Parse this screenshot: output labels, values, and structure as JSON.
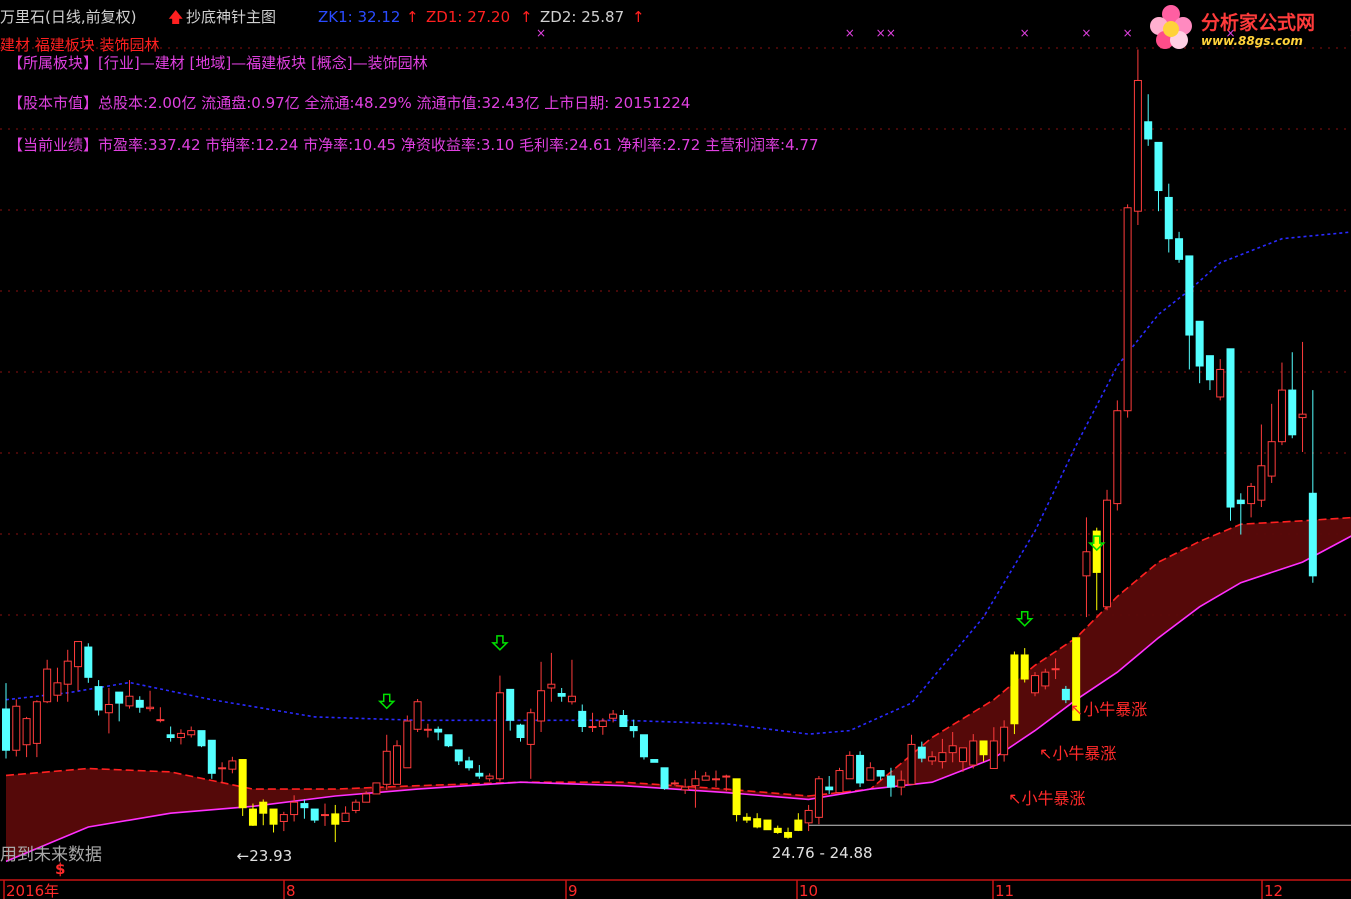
{
  "header": {
    "stock_name": "万里石(日线,前复权)",
    "indicator_name": "抄底神针主图",
    "zk1_label": "ZK1: 32.12",
    "zd1_label": "ZD1: 27.20",
    "zd2_label": "ZD2: 25.87"
  },
  "info": {
    "sector_short": "建材 福建板块 装饰园林",
    "sector_line": "【所属板块】[行业]—建材 [地域]—福建板块 [概念]—装饰园林",
    "equity_line": "【股本市值】总股本:2.00亿 流通盘:0.97亿 全流通:48.29% 流通市值:32.43亿 上市日期: 20151224",
    "performance_line": "【当前业绩】市盈率:337.42 市销率:12.24 市净率:10.45 净资收益率:3.10 毛利率:24.61 净利率:2.72 主营利润率:4.77"
  },
  "logo": {
    "title": "分析家公式网",
    "url": "www.88gs.com"
  },
  "footer": {
    "future_data_note": "用到未来数据",
    "dollar_mark": "$"
  },
  "colors": {
    "background": "#000000",
    "up_candle": "#ff3c3c",
    "down_candle": "#54ffff",
    "buy_signal_candle": "#ffff00",
    "band_fill": "#5a0a0a",
    "band_edge_red": "#ff2020",
    "band_edge_magenta": "#ff30ff",
    "blue_dotted_line": "#2a2aff",
    "grid": "#8a1010",
    "signal_arrow": "#00e000",
    "signal_text": "#ff2a2a",
    "header_text": "#d0d0d0",
    "info_text": "#e040e0"
  },
  "chart_data": {
    "type": "candlestick",
    "title": "抄底神针主图",
    "ylim": [
      21.3,
      46.3
    ],
    "x_ticks": [
      "2016年",
      "8",
      "9",
      "10",
      "11",
      "12"
    ],
    "candles": [
      {
        "o": 26.33,
        "h": 27.08,
        "l": 24.89,
        "c": 25.13
      },
      {
        "o": 25.13,
        "h": 26.61,
        "l": 24.95,
        "c": 26.41
      },
      {
        "o": 25.29,
        "h": 26.1,
        "l": 24.93,
        "c": 26.05
      },
      {
        "o": 25.33,
        "h": 26.58,
        "l": 24.93,
        "c": 26.54
      },
      {
        "o": 26.54,
        "h": 27.76,
        "l": 26.5,
        "c": 27.49
      },
      {
        "o": 26.73,
        "h": 27.53,
        "l": 26.54,
        "c": 27.09
      },
      {
        "o": 27.05,
        "h": 28.05,
        "l": 26.54,
        "c": 27.72
      },
      {
        "o": 27.56,
        "h": 28.29,
        "l": 26.86,
        "c": 28.29
      },
      {
        "o": 28.13,
        "h": 28.24,
        "l": 27.09,
        "c": 27.25
      },
      {
        "o": 26.98,
        "h": 27.17,
        "l": 26.14,
        "c": 26.3
      },
      {
        "o": 26.22,
        "h": 26.94,
        "l": 25.62,
        "c": 26.46
      },
      {
        "o": 26.82,
        "h": 26.82,
        "l": 25.97,
        "c": 26.5
      },
      {
        "o": 26.42,
        "h": 27.17,
        "l": 26.34,
        "c": 26.7
      },
      {
        "o": 26.58,
        "h": 26.7,
        "l": 26.22,
        "c": 26.38
      },
      {
        "o": 26.34,
        "h": 26.86,
        "l": 26.26,
        "c": 26.38
      },
      {
        "o": 26.02,
        "h": 26.38,
        "l": 25.94,
        "c": 26.02
      },
      {
        "o": 25.58,
        "h": 25.82,
        "l": 25.38,
        "c": 25.5
      },
      {
        "o": 25.5,
        "h": 25.74,
        "l": 25.3,
        "c": 25.62
      },
      {
        "o": 25.58,
        "h": 25.82,
        "l": 25.5,
        "c": 25.7
      },
      {
        "o": 25.7,
        "h": 25.7,
        "l": 25.22,
        "c": 25.26
      },
      {
        "o": 25.42,
        "h": 25.42,
        "l": 24.3,
        "c": 24.46
      },
      {
        "o": 24.62,
        "h": 24.78,
        "l": 24.18,
        "c": 24.62
      },
      {
        "o": 24.58,
        "h": 24.94,
        "l": 24.46,
        "c": 24.82
      },
      {
        "o": 24.86,
        "h": 24.86,
        "l": 23.22,
        "c": 23.46
      },
      {
        "o": 23.42,
        "h": 23.58,
        "l": 22.93,
        "c": 22.95
      },
      {
        "o": 23.3,
        "h": 23.7,
        "l": 22.95,
        "c": 23.62
      },
      {
        "o": 23.42,
        "h": 23.42,
        "l": 22.74,
        "c": 22.98
      },
      {
        "o": 23.06,
        "h": 23.34,
        "l": 22.78,
        "c": 23.26
      },
      {
        "o": 23.26,
        "h": 23.82,
        "l": 23.06,
        "c": 23.62
      },
      {
        "o": 23.58,
        "h": 23.7,
        "l": 23.14,
        "c": 23.46
      },
      {
        "o": 23.42,
        "h": 23.42,
        "l": 23.02,
        "c": 23.1
      },
      {
        "o": 23.26,
        "h": 23.58,
        "l": 22.93,
        "c": 23.26
      },
      {
        "o": 23.28,
        "h": 23.54,
        "l": 22.46,
        "c": 22.98
      },
      {
        "o": 23.06,
        "h": 23.5,
        "l": 23.06,
        "c": 23.3
      },
      {
        "o": 23.38,
        "h": 23.7,
        "l": 23.3,
        "c": 23.62
      },
      {
        "o": 23.62,
        "h": 23.94,
        "l": 23.62,
        "c": 23.86
      },
      {
        "o": 23.86,
        "h": 24.18,
        "l": 23.86,
        "c": 24.18
      },
      {
        "o": 24.14,
        "h": 25.58,
        "l": 23.98,
        "c": 25.1
      },
      {
        "o": 24.14,
        "h": 25.42,
        "l": 24.14,
        "c": 25.26
      },
      {
        "o": 24.62,
        "h": 26.14,
        "l": 24.62,
        "c": 25.98
      },
      {
        "o": 25.74,
        "h": 26.62,
        "l": 25.66,
        "c": 26.54
      },
      {
        "o": 25.74,
        "h": 25.9,
        "l": 25.5,
        "c": 25.74
      },
      {
        "o": 25.74,
        "h": 25.82,
        "l": 25.42,
        "c": 25.66
      },
      {
        "o": 25.58,
        "h": 25.58,
        "l": 25.22,
        "c": 25.26
      },
      {
        "o": 25.14,
        "h": 25.14,
        "l": 24.7,
        "c": 24.82
      },
      {
        "o": 24.82,
        "h": 24.94,
        "l": 24.54,
        "c": 24.62
      },
      {
        "o": 24.46,
        "h": 24.7,
        "l": 24.3,
        "c": 24.38
      },
      {
        "o": 24.3,
        "h": 24.46,
        "l": 24.22,
        "c": 24.38
      },
      {
        "o": 24.3,
        "h": 27.3,
        "l": 24.22,
        "c": 26.8
      },
      {
        "o": 26.9,
        "h": 26.9,
        "l": 25.7,
        "c": 26.0
      },
      {
        "o": 25.86,
        "h": 25.9,
        "l": 25.38,
        "c": 25.5
      },
      {
        "o": 25.3,
        "h": 26.34,
        "l": 24.3,
        "c": 26.22
      },
      {
        "o": 25.98,
        "h": 27.7,
        "l": 25.66,
        "c": 26.86
      },
      {
        "o": 26.94,
        "h": 27.96,
        "l": 26.54,
        "c": 27.05
      },
      {
        "o": 26.78,
        "h": 26.94,
        "l": 26.54,
        "c": 26.7
      },
      {
        "o": 26.54,
        "h": 27.76,
        "l": 26.46,
        "c": 26.7
      },
      {
        "o": 26.26,
        "h": 26.46,
        "l": 25.66,
        "c": 25.82
      },
      {
        "o": 25.82,
        "h": 26.22,
        "l": 25.66,
        "c": 25.82
      },
      {
        "o": 25.82,
        "h": 26.06,
        "l": 25.58,
        "c": 25.98
      },
      {
        "o": 26.06,
        "h": 26.3,
        "l": 25.94,
        "c": 26.18
      },
      {
        "o": 26.14,
        "h": 26.3,
        "l": 25.82,
        "c": 25.82
      },
      {
        "o": 25.82,
        "h": 26.02,
        "l": 25.5,
        "c": 25.7
      },
      {
        "o": 25.58,
        "h": 25.58,
        "l": 24.86,
        "c": 24.94
      },
      {
        "o": 24.86,
        "h": 24.86,
        "l": 24.78,
        "c": 24.78
      },
      {
        "o": 24.62,
        "h": 24.62,
        "l": 23.98,
        "c": 24.02
      },
      {
        "o": 24.18,
        "h": 24.26,
        "l": 24.1,
        "c": 24.18
      },
      {
        "o": 23.98,
        "h": 24.3,
        "l": 23.86,
        "c": 24.06
      },
      {
        "o": 24.1,
        "h": 24.54,
        "l": 23.46,
        "c": 24.3
      },
      {
        "o": 24.26,
        "h": 24.5,
        "l": 24.26,
        "c": 24.38
      },
      {
        "o": 24.3,
        "h": 24.54,
        "l": 24.06,
        "c": 24.3
      },
      {
        "o": 24.38,
        "h": 24.42,
        "l": 23.94,
        "c": 24.38
      },
      {
        "o": 24.3,
        "h": 24.3,
        "l": 23.06,
        "c": 23.26
      },
      {
        "o": 23.18,
        "h": 23.3,
        "l": 23.02,
        "c": 23.1
      },
      {
        "o": 23.14,
        "h": 23.3,
        "l": 22.86,
        "c": 22.9
      },
      {
        "o": 23.1,
        "h": 23.1,
        "l": 22.82,
        "c": 22.82
      },
      {
        "o": 22.86,
        "h": 22.94,
        "l": 22.7,
        "c": 22.74
      },
      {
        "o": 22.74,
        "h": 22.88,
        "l": 22.56,
        "c": 22.6
      },
      {
        "o": 22.8,
        "h": 23.3,
        "l": 22.78,
        "c": 23.1
      },
      {
        "o": 23.02,
        "h": 23.54,
        "l": 22.78,
        "c": 23.38
      },
      {
        "o": 23.18,
        "h": 24.38,
        "l": 22.98,
        "c": 24.3
      },
      {
        "o": 24.06,
        "h": 24.38,
        "l": 23.86,
        "c": 23.98
      },
      {
        "o": 23.9,
        "h": 24.62,
        "l": 23.86,
        "c": 24.54
      },
      {
        "o": 24.3,
        "h": 25.1,
        "l": 24.3,
        "c": 24.98
      },
      {
        "o": 24.98,
        "h": 25.1,
        "l": 24.06,
        "c": 24.18
      },
      {
        "o": 24.26,
        "h": 24.78,
        "l": 24.26,
        "c": 24.62
      },
      {
        "o": 24.54,
        "h": 24.54,
        "l": 24.26,
        "c": 24.38
      },
      {
        "o": 24.38,
        "h": 24.62,
        "l": 23.78,
        "c": 24.06
      },
      {
        "o": 24.06,
        "h": 24.54,
        "l": 23.82,
        "c": 24.26
      },
      {
        "o": 24.14,
        "h": 25.58,
        "l": 24.14,
        "c": 25.3
      },
      {
        "o": 25.22,
        "h": 25.38,
        "l": 24.78,
        "c": 24.9
      },
      {
        "o": 24.82,
        "h": 25.1,
        "l": 24.7,
        "c": 24.94
      },
      {
        "o": 24.8,
        "h": 25.46,
        "l": 24.6,
        "c": 25.06
      },
      {
        "o": 25.06,
        "h": 25.66,
        "l": 24.78,
        "c": 25.26
      },
      {
        "o": 24.8,
        "h": 25.2,
        "l": 24.5,
        "c": 25.2
      },
      {
        "o": 24.7,
        "h": 25.6,
        "l": 24.6,
        "c": 25.4
      },
      {
        "o": 25.0,
        "h": 25.4,
        "l": 24.8,
        "c": 25.4
      },
      {
        "o": 24.6,
        "h": 25.8,
        "l": 24.6,
        "c": 25.4
      },
      {
        "o": 25.0,
        "h": 26.0,
        "l": 24.8,
        "c": 25.8
      },
      {
        "o": 25.9,
        "h": 28.0,
        "l": 25.6,
        "c": 27.9
      },
      {
        "o": 27.9,
        "h": 28.1,
        "l": 27.1,
        "c": 27.2
      },
      {
        "o": 26.8,
        "h": 27.4,
        "l": 26.7,
        "c": 27.3
      },
      {
        "o": 27.0,
        "h": 27.5,
        "l": 26.9,
        "c": 27.4
      },
      {
        "o": 27.5,
        "h": 27.8,
        "l": 27.2,
        "c": 27.5
      },
      {
        "o": 26.9,
        "h": 27.0,
        "l": 26.5,
        "c": 26.6
      },
      {
        "o": 26.0,
        "h": 28.4,
        "l": 26.0,
        "c": 28.4
      },
      {
        "o": 30.2,
        "h": 31.9,
        "l": 29.0,
        "c": 30.9
      },
      {
        "o": 31.5,
        "h": 31.6,
        "l": 29.2,
        "c": 30.3
      },
      {
        "o": 29.3,
        "h": 32.7,
        "l": 29.2,
        "c": 32.4
      },
      {
        "o": 32.3,
        "h": 35.3,
        "l": 32.1,
        "c": 35.0
      },
      {
        "o": 35.0,
        "h": 41.0,
        "l": 34.8,
        "c": 40.9
      },
      {
        "o": 40.8,
        "h": 45.5,
        "l": 40.4,
        "c": 44.6
      },
      {
        "o": 43.4,
        "h": 44.2,
        "l": 42.7,
        "c": 42.9
      },
      {
        "o": 42.8,
        "h": 42.8,
        "l": 40.8,
        "c": 41.4
      },
      {
        "o": 41.2,
        "h": 41.6,
        "l": 39.6,
        "c": 40.0
      },
      {
        "o": 40.0,
        "h": 40.2,
        "l": 39.3,
        "c": 39.4
      },
      {
        "o": 39.5,
        "h": 39.5,
        "l": 36.2,
        "c": 37.2
      },
      {
        "o": 37.6,
        "h": 37.6,
        "l": 35.8,
        "c": 36.3
      },
      {
        "o": 36.6,
        "h": 36.6,
        "l": 35.6,
        "c": 35.9
      },
      {
        "o": 35.4,
        "h": 36.5,
        "l": 35.3,
        "c": 36.2
      },
      {
        "o": 36.8,
        "h": 36.8,
        "l": 31.8,
        "c": 32.2
      },
      {
        "o": 32.4,
        "h": 32.6,
        "l": 31.4,
        "c": 32.3
      },
      {
        "o": 32.3,
        "h": 32.9,
        "l": 31.9,
        "c": 32.8
      },
      {
        "o": 32.4,
        "h": 34.6,
        "l": 32.2,
        "c": 33.4
      },
      {
        "o": 33.1,
        "h": 35.2,
        "l": 32.9,
        "c": 34.1
      },
      {
        "o": 34.1,
        "h": 36.4,
        "l": 34.0,
        "c": 35.6
      },
      {
        "o": 35.6,
        "h": 36.7,
        "l": 34.2,
        "c": 34.3
      },
      {
        "o": 34.8,
        "h": 37.0,
        "l": 33.8,
        "c": 34.9
      },
      {
        "o": 32.6,
        "h": 35.6,
        "l": 30.0,
        "c": 30.2
      }
    ],
    "signal_candles": [
      {
        "index": 23,
        "color": "#ffff00"
      },
      {
        "index": 24,
        "color": "#ffff00"
      },
      {
        "index": 25,
        "color": "#ffff00"
      },
      {
        "index": 26,
        "color": "#ffff00"
      },
      {
        "index": 32,
        "color": "#ffff00"
      },
      {
        "index": 71,
        "color": "#ffff00"
      },
      {
        "index": 72,
        "color": "#ffff00"
      },
      {
        "index": 73,
        "color": "#ffff00"
      },
      {
        "index": 74,
        "color": "#ffff00"
      },
      {
        "index": 75,
        "color": "#ffff00"
      },
      {
        "index": 76,
        "color": "#ffff00"
      },
      {
        "index": 77,
        "color": "#ffff00"
      },
      {
        "index": 95,
        "color": "#ffff00"
      },
      {
        "index": 98,
        "color": "#ffff00"
      },
      {
        "index": 99,
        "color": "#ffff00"
      },
      {
        "index": 104,
        "color": "#ffff00"
      },
      {
        "index": 106,
        "color": "#ffff00"
      }
    ],
    "series": [
      {
        "name": "blue_dotted",
        "color": "#2a2aff",
        "dash": "3,3",
        "points": [
          [
            0,
            26.6
          ],
          [
            6,
            26.8
          ],
          [
            12,
            27.1
          ],
          [
            20,
            26.6
          ],
          [
            30,
            26.1
          ],
          [
            40,
            26.0
          ],
          [
            50,
            26.0
          ],
          [
            60,
            26.0
          ],
          [
            70,
            25.9
          ],
          [
            78,
            25.6
          ],
          [
            82,
            25.7
          ],
          [
            88,
            26.5
          ],
          [
            95,
            29.0
          ],
          [
            100,
            31.5
          ],
          [
            104,
            34.0
          ],
          [
            108,
            36.3
          ],
          [
            112,
            37.8
          ],
          [
            115,
            38.5
          ],
          [
            118,
            39.3
          ],
          [
            124,
            40.0
          ],
          [
            131,
            40.2
          ]
        ]
      },
      {
        "name": "band_upper",
        "color": "#ff2020",
        "dash": "8,4",
        "points": [
          [
            0,
            24.4
          ],
          [
            8,
            24.6
          ],
          [
            16,
            24.5
          ],
          [
            24,
            24.0
          ],
          [
            32,
            24.0
          ],
          [
            40,
            24.1
          ],
          [
            50,
            24.2
          ],
          [
            60,
            24.2
          ],
          [
            70,
            24.0
          ],
          [
            78,
            23.8
          ],
          [
            84,
            24.0
          ],
          [
            90,
            25.5
          ],
          [
            96,
            26.6
          ],
          [
            100,
            27.6
          ],
          [
            104,
            28.4
          ],
          [
            108,
            29.6
          ],
          [
            112,
            30.6
          ],
          [
            116,
            31.2
          ],
          [
            120,
            31.7
          ],
          [
            126,
            31.8
          ],
          [
            131,
            31.9
          ]
        ]
      },
      {
        "name": "band_lower",
        "color": "#ff30ff",
        "dash": "",
        "points": [
          [
            0,
            21.9
          ],
          [
            8,
            22.9
          ],
          [
            16,
            23.3
          ],
          [
            24,
            23.5
          ],
          [
            32,
            23.8
          ],
          [
            40,
            24.0
          ],
          [
            50,
            24.2
          ],
          [
            60,
            24.1
          ],
          [
            70,
            23.9
          ],
          [
            78,
            23.7
          ],
          [
            84,
            24.0
          ],
          [
            90,
            24.2
          ],
          [
            96,
            24.9
          ],
          [
            100,
            25.7
          ],
          [
            104,
            26.6
          ],
          [
            108,
            27.4
          ],
          [
            112,
            28.4
          ],
          [
            116,
            29.3
          ],
          [
            120,
            30.0
          ],
          [
            126,
            30.6
          ],
          [
            131,
            31.4
          ]
        ]
      }
    ],
    "hline": {
      "value": 22.95,
      "from_index": 78
    },
    "down_arrows": [
      {
        "index": 37,
        "value": 26.0
      },
      {
        "index": 48,
        "value": 27.7
      },
      {
        "index": 99,
        "value": 28.4
      },
      {
        "index": 106,
        "value": 30.6
      }
    ],
    "annotations": [
      {
        "text": "←23.93",
        "index": 23,
        "value": 22.2
      },
      {
        "text": "24.76 - 24.88",
        "index": 75,
        "value": 22.3
      },
      {
        "text": "↖小牛暴涨",
        "index": 103,
        "value": 26.6
      },
      {
        "text": "↖小牛暴涨",
        "index": 100,
        "value": 25.3
      },
      {
        "text": "↖小牛暴涨",
        "index": 97,
        "value": 24.0
      }
    ],
    "magenta_x_marks": [
      52,
      82,
      85,
      86,
      99,
      105,
      109,
      119,
      131
    ]
  }
}
